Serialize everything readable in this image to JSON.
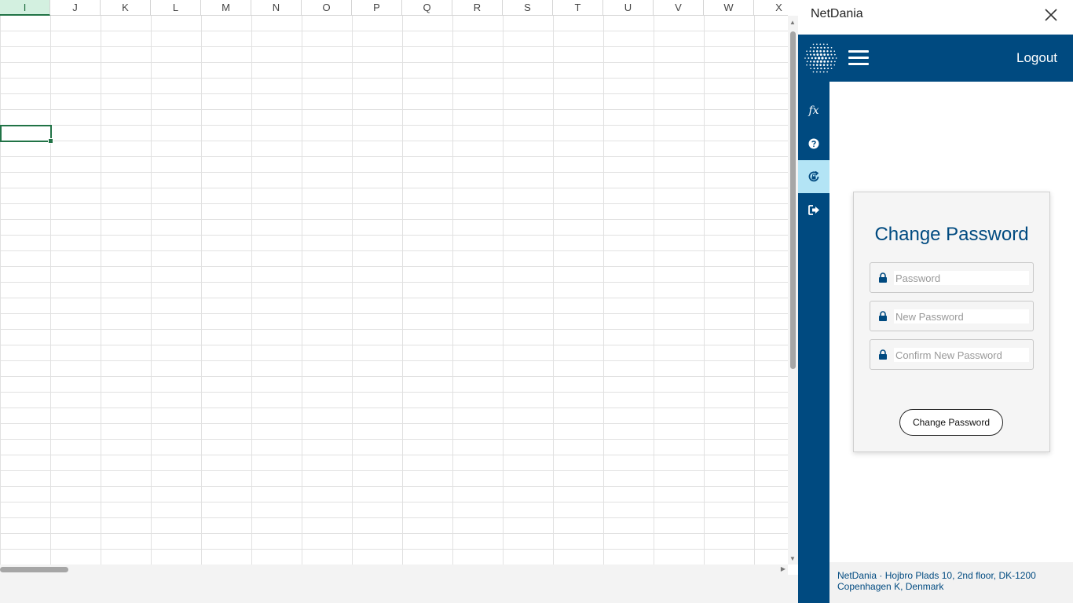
{
  "sheet": {
    "columns": [
      "I",
      "J",
      "K",
      "L",
      "M",
      "N",
      "O",
      "P",
      "Q",
      "R",
      "S",
      "T",
      "U",
      "V",
      "W",
      "X"
    ],
    "selected_column": "I"
  },
  "pane": {
    "title": "NetDania",
    "close_icon": "close-icon",
    "topbar": {
      "logo_icon": "netdania-logo",
      "menu_icon": "hamburger-menu-icon",
      "logout_label": "Logout",
      "background_color": "#004a80"
    },
    "sidenav": {
      "items": [
        {
          "name": "functions",
          "label": "fx",
          "icon": "fx-icon"
        },
        {
          "name": "help",
          "icon": "help-icon"
        },
        {
          "name": "change-password",
          "icon": "password-icon",
          "active": true
        },
        {
          "name": "signout",
          "icon": "signout-icon"
        }
      ],
      "active_color": "#b3e4f5"
    },
    "form": {
      "title": "Change Password",
      "fields": [
        {
          "placeholder": "Password",
          "value": ""
        },
        {
          "placeholder": "New Password",
          "value": ""
        },
        {
          "placeholder": "Confirm New Password",
          "value": ""
        }
      ],
      "submit_label": "Change Password"
    },
    "footer": {
      "line1": "NetDania · Hojbro Plads 10, 2nd floor, DK-1200",
      "line2": "Copenhagen K, Denmark"
    }
  }
}
